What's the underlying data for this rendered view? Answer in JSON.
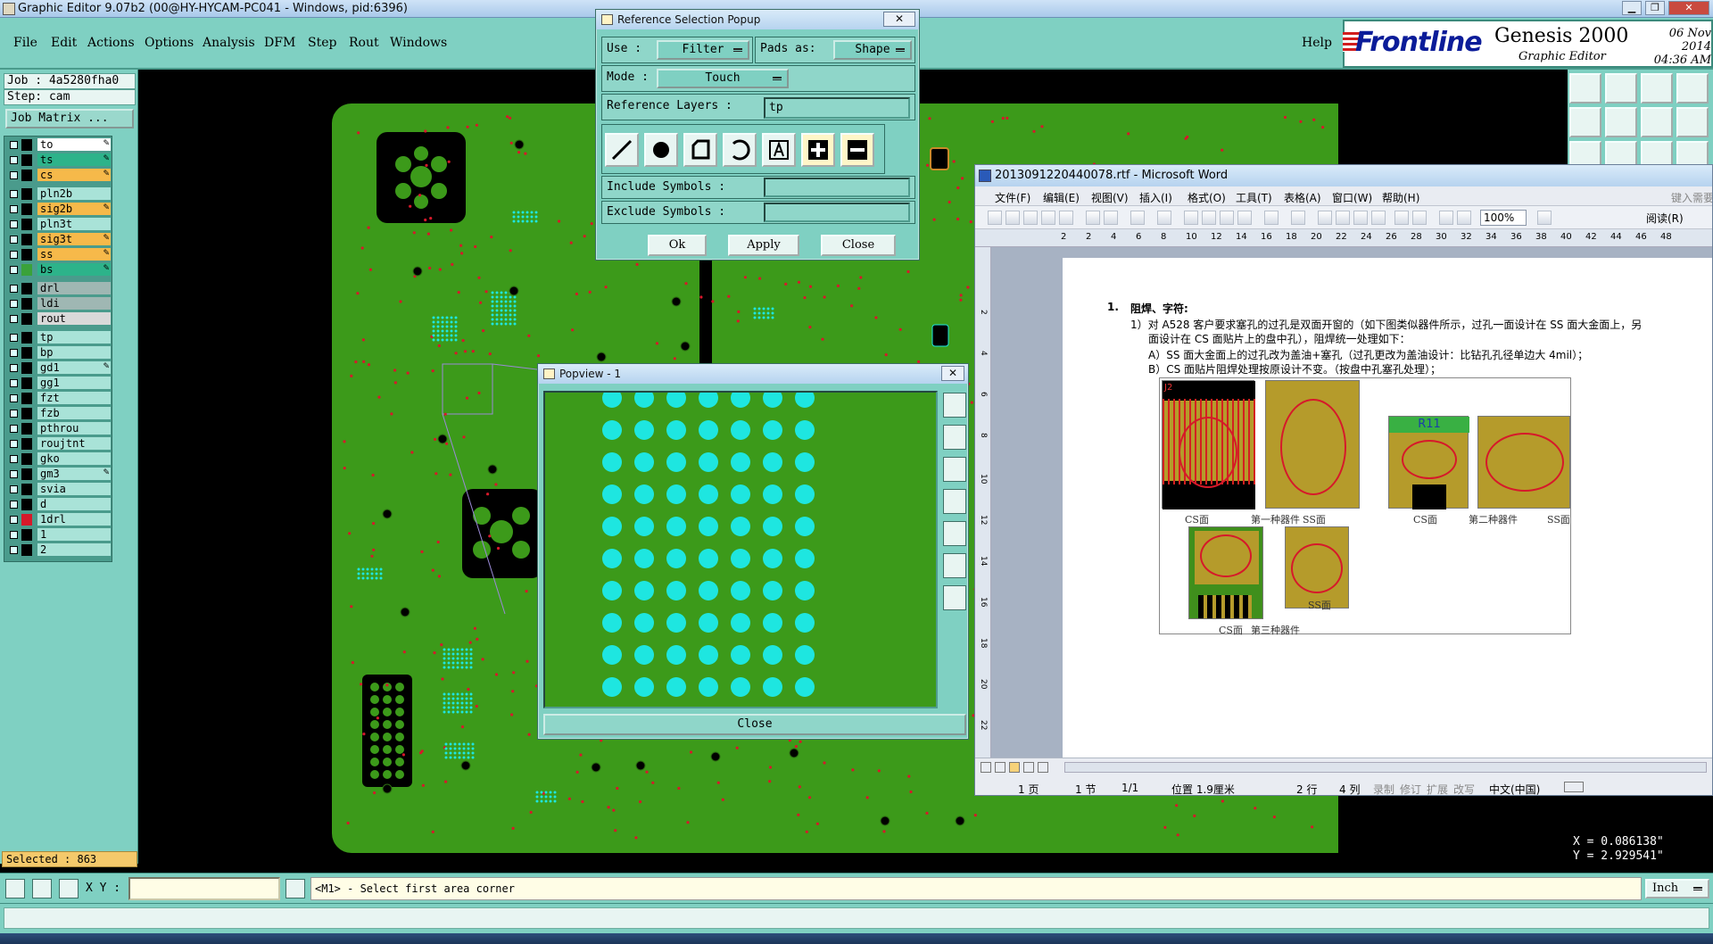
{
  "window": {
    "title": "Graphic Editor 9.07b2 (00@HY-HYCAM-PC041 - Windows, pid:6396)",
    "min_label": "▁",
    "max_label": "❐",
    "close_label": "✕"
  },
  "menubar": {
    "items": [
      "File",
      "Edit",
      "Actions",
      "Options",
      "Analysis",
      "DFM",
      "Step",
      "Rout",
      "Windows"
    ],
    "help": "Help"
  },
  "brand": {
    "logo": "Frontline",
    "product": "Genesis 2000",
    "subtitle": "Graphic Editor",
    "date": "06 Nov 2014",
    "time": "04:36 AM"
  },
  "job_panel": {
    "job": "Job : 4a5280fha0",
    "step": "Step: cam",
    "job_matrix_label": "Job Matrix ...",
    "selected": "Selected : 863"
  },
  "layers": [
    {
      "name": "to",
      "color": "#ffffff",
      "swatch": "#000000",
      "editable": true
    },
    {
      "name": "ts",
      "color": "#2db38a",
      "swatch": "#000000",
      "editable": true
    },
    {
      "name": "cs",
      "color": "#f6b94a",
      "swatch": "#000000",
      "editable": true
    },
    {
      "name": "pln2b",
      "color": "#a9e3d8",
      "swatch": "#000000",
      "editable": false
    },
    {
      "name": "sig2b",
      "color": "#f6b94a",
      "swatch": "#000000",
      "editable": true
    },
    {
      "name": "pln3t",
      "color": "#a9e3d8",
      "swatch": "#000000",
      "editable": false
    },
    {
      "name": "sig3t",
      "color": "#f6b94a",
      "swatch": "#000000",
      "editable": true
    },
    {
      "name": "ss",
      "color": "#f6b94a",
      "swatch": "#000000",
      "editable": true
    },
    {
      "name": "bs",
      "color": "#2db38a",
      "swatch": "#3aa23a",
      "editable": true
    },
    {
      "name": "drl",
      "color": "#9fb7b3",
      "swatch": "#000000",
      "editable": false
    },
    {
      "name": "ldi",
      "color": "#9fb7b3",
      "swatch": "#000000",
      "editable": false
    },
    {
      "name": "rout",
      "color": "#d9d9d9",
      "swatch": "#000000",
      "editable": false
    },
    {
      "name": "tp",
      "color": "#a9e3d8",
      "swatch": "#000000",
      "editable": false
    },
    {
      "name": "bp",
      "color": "#a9e3d8",
      "swatch": "#000000",
      "editable": false
    },
    {
      "name": "gd1",
      "color": "#a9e3d8",
      "swatch": "#000000",
      "editable": true
    },
    {
      "name": "gg1",
      "color": "#a9e3d8",
      "swatch": "#000000",
      "editable": false
    },
    {
      "name": "fzt",
      "color": "#a9e3d8",
      "swatch": "#000000",
      "editable": false
    },
    {
      "name": "fzb",
      "color": "#a9e3d8",
      "swatch": "#000000",
      "editable": false
    },
    {
      "name": "pthrou",
      "color": "#a9e3d8",
      "swatch": "#000000",
      "editable": false
    },
    {
      "name": "roujtnt",
      "color": "#a9e3d8",
      "swatch": "#000000",
      "editable": false
    },
    {
      "name": "gko",
      "color": "#a9e3d8",
      "swatch": "#000000",
      "editable": false
    },
    {
      "name": "gm3",
      "color": "#a9e3d8",
      "swatch": "#000000",
      "editable": true
    },
    {
      "name": "svia",
      "color": "#a9e3d8",
      "swatch": "#000000",
      "editable": false
    },
    {
      "name": "d",
      "color": "#a9e3d8",
      "swatch": "#000000",
      "editable": false
    },
    {
      "name": "1drl",
      "color": "#a9e3d8",
      "swatch": "#d6192a",
      "editable": false
    },
    {
      "name": "1",
      "color": "#a9e3d8",
      "swatch": "#000000",
      "editable": false
    },
    {
      "name": "2",
      "color": "#a9e3d8",
      "swatch": "#000000",
      "editable": false
    }
  ],
  "ref_popup": {
    "title": "Reference Selection Popup",
    "close_label": "✕",
    "use_label": "Use   :",
    "use_value": "Filter",
    "pads_label": "Pads as:",
    "pads_value": "Shape",
    "mode_label": "Mode  :",
    "mode_value": "Touch",
    "ref_layers_label": "Reference Layers :",
    "ref_layers_value": "tp",
    "include_label": "Include Symbols :",
    "include_value": "",
    "exclude_label": "Exclude Symbols :",
    "exclude_value": "",
    "shape_icons": [
      "line-icon",
      "pad-circle-icon",
      "surface-icon",
      "arc-icon",
      "text-icon",
      "positive-icon",
      "negative-icon"
    ],
    "ok": "Ok",
    "apply": "Apply",
    "close": "Close"
  },
  "popview": {
    "title": "Popview - 1",
    "close_x": "✕",
    "close": "Close",
    "pad_color": "#1ee6e0",
    "board_color": "#3c9a1a"
  },
  "word": {
    "title": "2013091220440078.rtf - Microsoft Word",
    "menu": [
      "文件(F)",
      "编辑(E)",
      "视图(V)",
      "插入(I)",
      "格式(O)",
      "工具(T)",
      "表格(A)",
      "窗口(W)",
      "帮助(H)"
    ],
    "search_hint": "键入需要",
    "zoom": "100%",
    "reading": "阅读(R)",
    "ruler_ticks": [
      "2",
      "2",
      "4",
      "6",
      "8",
      "10",
      "12",
      "14",
      "16",
      "18",
      "20",
      "22",
      "24",
      "26",
      "28",
      "30",
      "32",
      "34",
      "36",
      "38",
      "40",
      "42",
      "44",
      "46",
      "48"
    ],
    "vruler_ticks": [
      "2",
      "4",
      "6",
      "8",
      "10",
      "12",
      "14",
      "16",
      "18",
      "20",
      "22"
    ],
    "heading_num": "1.",
    "heading": "阻焊、字符:",
    "line1": "1）对 A528 客户要求塞孔的过孔是双面开窗的（如下图类似器件所示，过孔一面设计在 SS 面大金面上，另",
    "line2": "面设计在 CS 面贴片上的盘中孔），阻焊统一处理如下：",
    "line3": "A）SS 面大金面上的过孔改为盖油+塞孔（过孔更改为盖油设计：比钻孔孔径单边大 4mil）；",
    "line4": "B）CS 面贴片阻焊处理按原设计不变。（按盘中孔塞孔处理）；",
    "captions": {
      "cs1": "CS面",
      "first": "第一种器件",
      "ss1": "SS面",
      "cs2": "CS面",
      "second": "第二种器件",
      "ss2": "SS面",
      "cs3": "CS面",
      "third": "第三种器件",
      "ss3": "SS面",
      "r11": "R11",
      "j2": "J2"
    },
    "status": {
      "page": "1 页",
      "section": "1 节",
      "pages": "1/1",
      "position": "位置 1.9厘米",
      "line": "2 行",
      "column": "4 列",
      "rec": "录制",
      "trk": "修订",
      "ext": "扩展",
      "ovr": "改写",
      "lang": "中文(中国)"
    }
  },
  "coords": {
    "x": "X = 0.086138\"",
    "y": "Y = 2.929541\""
  },
  "statusbar": {
    "xy_label": "X Y :",
    "xy_value": "",
    "message": "<M1> - Select first area corner",
    "unit": "Inch"
  }
}
